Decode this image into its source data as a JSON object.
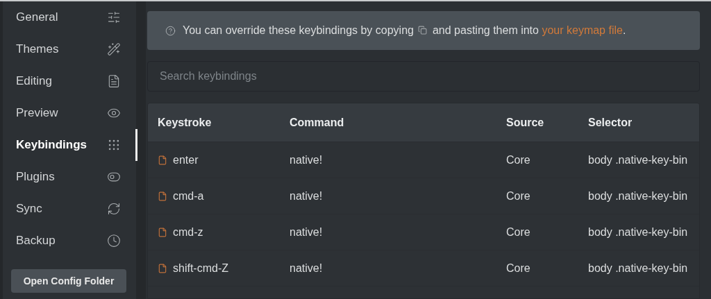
{
  "sidebar": {
    "items": [
      {
        "label": "General",
        "selected": false
      },
      {
        "label": "Themes",
        "selected": false
      },
      {
        "label": "Editing",
        "selected": false
      },
      {
        "label": "Preview",
        "selected": false
      },
      {
        "label": "Keybindings",
        "selected": true
      },
      {
        "label": "Plugins",
        "selected": false
      },
      {
        "label": "Sync",
        "selected": false
      },
      {
        "label": "Backup",
        "selected": false
      }
    ],
    "button": "Open Config Folder"
  },
  "notice": {
    "before": "You can override these keybindings by copying",
    "after": "and pasting them into",
    "link": "your keymap file",
    "end": "."
  },
  "search": {
    "placeholder": "Search keybindings"
  },
  "table": {
    "columns": [
      "Keystroke",
      "Command",
      "Source",
      "Selector"
    ],
    "rows": [
      {
        "keystroke": "enter",
        "command": "native!",
        "source": "Core",
        "selector": "body .native-key-bin"
      },
      {
        "keystroke": "cmd-a",
        "command": "native!",
        "source": "Core",
        "selector": "body .native-key-bin"
      },
      {
        "keystroke": "cmd-z",
        "command": "native!",
        "source": "Core",
        "selector": "body .native-key-bin"
      },
      {
        "keystroke": "shift-cmd-Z",
        "command": "native!",
        "source": "Core",
        "selector": "body .native-key-bin"
      }
    ]
  }
}
